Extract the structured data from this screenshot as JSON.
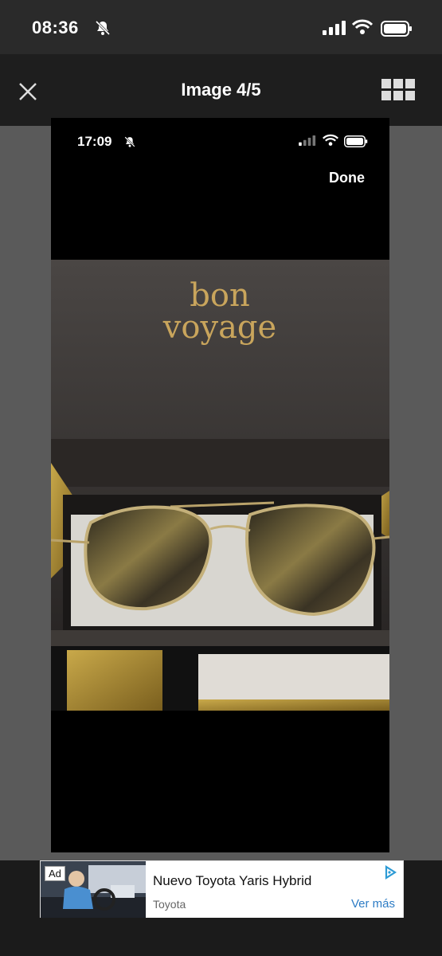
{
  "status_bar": {
    "time": "08:36"
  },
  "header": {
    "title": "Image 4/5"
  },
  "inner_screenshot": {
    "time": "17:09",
    "done_label": "Done",
    "photo_logo": [
      "bon",
      "voyage"
    ]
  },
  "ad": {
    "badge": "Ad",
    "title": "Nuevo Toyota Yaris Hybrid",
    "brand": "Toyota",
    "cta": "Ver más"
  },
  "colors": {
    "accent_link": "#2d7cc5",
    "header_bg": "#1e1e1e",
    "viewer_bg": "#5a5a5a"
  }
}
